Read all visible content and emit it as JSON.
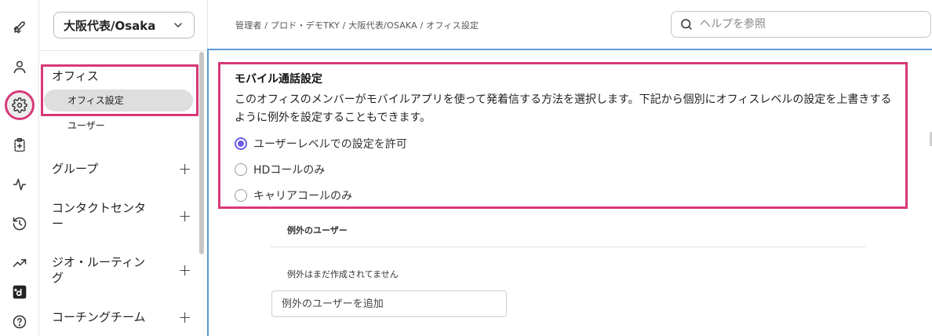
{
  "rail": {
    "icons": [
      "rocket-icon",
      "user-icon",
      "gear-icon",
      "clipboard-icon",
      "activity-icon",
      "history-icon",
      "trending-icon",
      "dialpad-logo-icon",
      "help-icon"
    ]
  },
  "sidebar": {
    "office_selector": "大阪代表/Osaka",
    "office_heading": "オフィス",
    "office_settings": "オフィス設定",
    "users": "ユーザー",
    "groups": [
      {
        "label": "グループ"
      },
      {
        "label": "コンタクトセンター"
      },
      {
        "label": "ジオ・ルーティング"
      },
      {
        "label": "コーチングチーム"
      }
    ]
  },
  "header": {
    "breadcrumb": "管理者 / プロド・デモTKY / 大阪代表/OSAKA / オフィス設定",
    "help_placeholder": "ヘルプを参照"
  },
  "mobile_calling": {
    "title": "モバイル通話設定",
    "description": "このオフィスのメンバーがモバイルアプリを使って発着信する方法を選択します。下記から個別にオフィスレベルの設定を上書きするように例外を設定することもできます。",
    "options": [
      {
        "label": "ユーザーレベルでの設定を許可",
        "checked": true
      },
      {
        "label": "HDコールのみ",
        "checked": false
      },
      {
        "label": "キャリアコールのみ",
        "checked": false
      }
    ]
  },
  "exceptions": {
    "heading": "例外のユーザー",
    "empty_text": "例外はまだ作成されてません",
    "add_placeholder": "例外のユーザーを追加"
  },
  "colors": {
    "highlight": "#d63a78",
    "radio_accent": "#6b5ce7",
    "panel_border": "#5b9bd5"
  }
}
